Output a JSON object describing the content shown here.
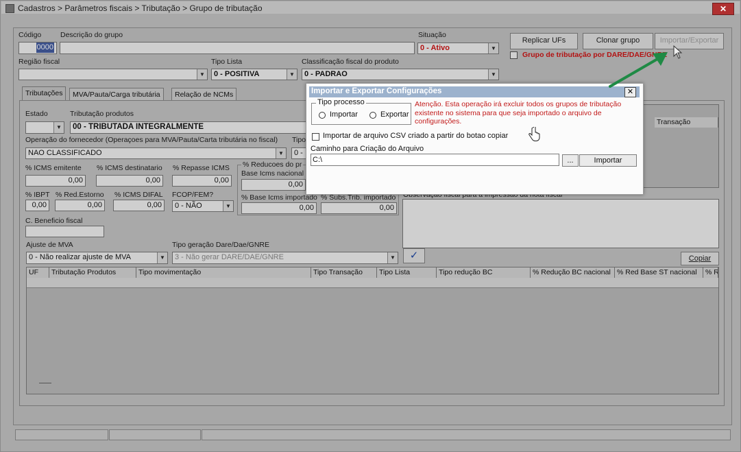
{
  "window": {
    "title": "Cadastros > Parâmetros fiscais > Tributação > Grupo de tributação",
    "close_label": "✕"
  },
  "form": {
    "codigo_label": "Código",
    "codigo_value": "0000",
    "descricao_label": "Descrição do grupo",
    "descricao_value": "",
    "situacao_label": "Situação",
    "situacao_value": "0 - Ativo",
    "replicar_ufs": "Replicar UFs",
    "clonar_grupo": "Clonar grupo",
    "importar_exportar": "Importar/Exportar",
    "grupo_dare_label": "Grupo de tributação por DARE/DAE/GNRE",
    "regiao_fiscal_label": "Região fiscal",
    "regiao_fiscal_value": "",
    "tipo_lista_label": "Tipo Lista",
    "tipo_lista_value": "0 - POSITIVA",
    "classificacao_label": "Classificação fiscal do produto",
    "classificacao_value": "0 - PADRAO"
  },
  "tabs": [
    {
      "label": "Tributações"
    },
    {
      "label": "MVA/Pauta/Carga tributária"
    },
    {
      "label": "Relação de NCMs"
    }
  ],
  "tributacoes": {
    "estado_label": "Estado",
    "estado_value": "",
    "trib_produtos_label": "Tributação produtos",
    "trib_produtos_value": "00 - TRIBUTADA INTEGRALMENTE",
    "operacao_label": "Operação do fornecedor (Operaçoes para MVA/Pauta/Carta tributária no fiscal)",
    "operacao_value": "NAO CLASSIFICADO",
    "tipo_label": "Tipo",
    "tipo_value": "0 -",
    "icms_emitente_label": "% ICMS emitente",
    "icms_emitente_value": "0,00",
    "icms_destinatario_label": "% ICMS destinatario",
    "icms_destinatario_value": "0,00",
    "repasse_icms_label": "% Repasse ICMS",
    "repasse_icms_value": "0,00",
    "reducoes_label": "% Reducoes do pr",
    "base_icms_nacional_label": "Base Icms nacional",
    "base_icms_nacional_value": "0,00",
    "ibpt_label": "% IBPT",
    "ibpt_value": "0,00",
    "red_estorno_label": "% Red.Estorno",
    "red_estorno_value": "0,00",
    "icms_difal_label": "% ICMS DIFAL",
    "icms_difal_value": "0,00",
    "fcop_label": "FCOP/FEM?",
    "fcop_value": "0 - NÃO",
    "base_icms_importado_label": "% Base Icms importado",
    "base_icms_importado_value": "0,00",
    "subs_trib_importado_label": "% Subs.Trib. importado",
    "subs_trib_importado_value": "0,00",
    "obs_fiscal_label": "Observação fiscal para a impressão da nota fiscal",
    "c_beneficio_label": "C. Beneficio fiscal",
    "c_beneficio_value": "",
    "ajuste_mva_label": "Ajuste de MVA",
    "ajuste_mva_value": "0 - Não realizar ajuste de MVA",
    "tipo_geracao_label": "Tipo geração Dare/Dae/GNRE",
    "tipo_geracao_value": "3 - Não gerar DARE/DAE/GNRE",
    "copiar": "Copiar",
    "transacao_header": "Transação"
  },
  "grid": {
    "columns": [
      "UF",
      "Tributação Produtos",
      "Tipo movimentação",
      "Tipo Transação",
      "Tipo Lista",
      "Tipo redução BC",
      "% Redução BC nacional",
      "% Red Base ST nacional",
      "% Re"
    ]
  },
  "dialog": {
    "title": "Importar e Exportar Configurações",
    "close_label": "✕",
    "tipo_processo_label": "Tipo processo",
    "importar_option": "Importar",
    "exportar_option": "Exportar",
    "warning": "Atenção. Esta operação irá excluir todos os grupos de tributação existente no sistema para que seja importado o arquivo de configurações.",
    "csv_checkbox_label": "Importar de arquivo CSV criado a partir do botao copiar",
    "caminho_label": "Caminho para Criação do Arquivo",
    "caminho_value": "C:\\",
    "browse_label": "...",
    "importar_button": "Importar"
  },
  "colors": {
    "arrow": "#1f8a45",
    "warning_text": "#c21b1b",
    "dialog_title_bg": "#9cb2cd"
  }
}
